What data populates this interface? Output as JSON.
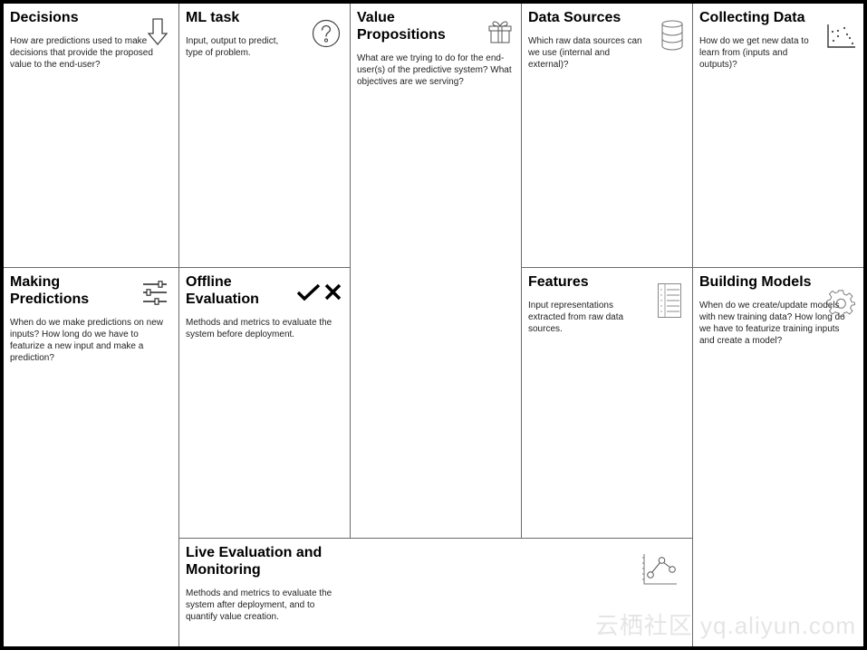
{
  "canvas": {
    "sections": {
      "decisions": {
        "title": "Decisions",
        "description": "How are predictions used to make decisions that provide the proposed value to the end-user?",
        "icon": "arrow-down-icon"
      },
      "ml_task": {
        "title": "ML task",
        "description": "Input, output to predict, type of problem.",
        "icon": "question-circle-icon"
      },
      "value_propositions": {
        "title": "Value Propositions",
        "description": "What are we trying to do for the end-user(s) of the predictive system? What objectives are we serving?",
        "icon": "gift-icon"
      },
      "data_sources": {
        "title": "Data Sources",
        "description": "Which raw data sources can we use (internal and external)?",
        "icon": "database-icon"
      },
      "collecting_data": {
        "title": "Collecting Data",
        "description": "How do we get new data to learn from (inputs and outputs)?",
        "icon": "scatter-plot-icon"
      },
      "making_predictions": {
        "title": "Making Predictions",
        "description": "When do we make predictions on new inputs? How long do we have to featurize a new input and make a prediction?",
        "icon": "sliders-icon"
      },
      "offline_evaluation": {
        "title": "Offline Evaluation",
        "description": "Methods and metrics to evaluate the system before deployment.",
        "icon": "check-cross-icon"
      },
      "features": {
        "title": "Features",
        "description": "Input representations extracted from raw data sources.",
        "icon": "list-icon"
      },
      "building_models": {
        "title": "Building Models",
        "description": "When do we create/update models with new training data? How long do we have to featurize training inputs and create a model?",
        "icon": "gear-icon"
      },
      "live_evaluation": {
        "title": "Live Evaluation and Monitoring",
        "description": "Methods and metrics to evaluate the system after deployment, and to quantify value creation.",
        "icon": "line-chart-icon"
      }
    }
  },
  "watermark": "云栖社区 yq.aliyun.com"
}
